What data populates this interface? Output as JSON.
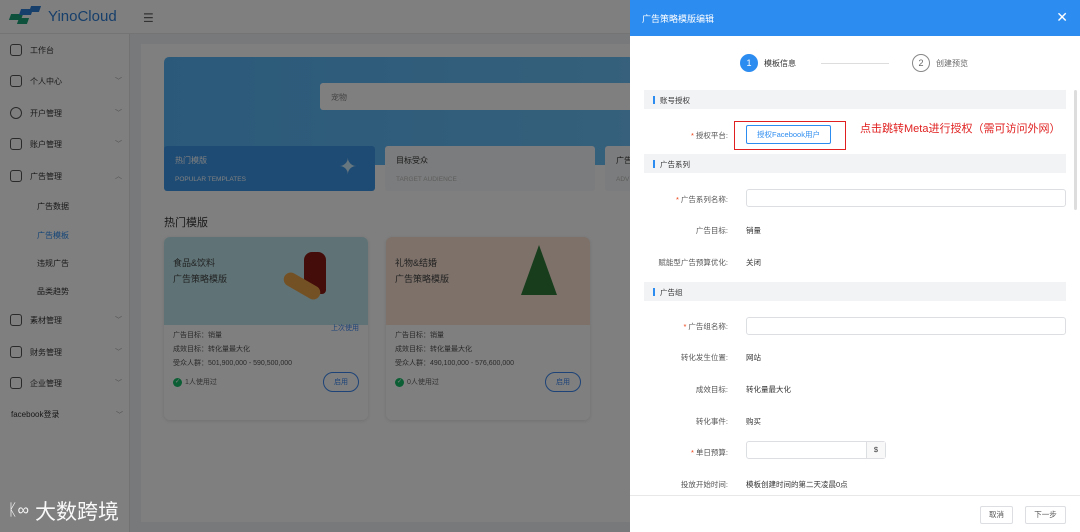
{
  "header": {
    "logo_text": "YinoCloud",
    "menu_icon": "menu-fold-icon"
  },
  "sidebar": {
    "items": [
      {
        "label": "工作台",
        "icon": "home-icon"
      },
      {
        "label": "个人中心",
        "icon": "user-icon"
      },
      {
        "label": "开户管理",
        "icon": "account-open-icon"
      },
      {
        "label": "账户管理",
        "icon": "layers-icon"
      },
      {
        "label": "广告管理",
        "icon": "ad-icon"
      },
      {
        "label": "素材管理",
        "icon": "image-icon"
      },
      {
        "label": "财务管理",
        "icon": "wallet-icon"
      },
      {
        "label": "企业管理",
        "icon": "building-icon"
      },
      {
        "label": "facebook登录",
        "icon": ""
      }
    ],
    "sub_items": [
      "广告数据",
      "广告模板",
      "违规广告",
      "品类趋势"
    ],
    "active_sub": "广告模板"
  },
  "main": {
    "search_value": "宠物",
    "tabs": [
      {
        "title": "热门模版",
        "subtitle": "POPULAR TEMPLATES"
      },
      {
        "title": "目标受众",
        "subtitle": "TARGET AUDIENCE"
      },
      {
        "title": "广告",
        "subtitle": "ADV"
      }
    ],
    "section_title": "热门模版",
    "cards": [
      {
        "title1": "食品&饮料",
        "title2": "广告策略模版",
        "goal": "广告目标：销量",
        "result": "成效目标：转化量最大化",
        "audience": "受众人群：501,900,000 - 590,500,000",
        "used": "1人使用过",
        "last_used": "上次使用",
        "button": "启用"
      },
      {
        "title1": "礼物&结婚",
        "title2": "广告策略模版",
        "goal": "广告目标：销量",
        "result": "成效目标：转化量最大化",
        "audience": "受众人群：490,100,000 - 576,600,000",
        "used": "0人使用过",
        "button": "启用"
      }
    ]
  },
  "watermark": "大数跨境",
  "drawer": {
    "title": "广告策略模版编辑",
    "steps": [
      {
        "num": "1",
        "label": "模板信息"
      },
      {
        "num": "2",
        "label": "创建预览"
      }
    ],
    "sections": {
      "auth": "账号授权",
      "campaign": "广告系列",
      "adset": "广告组"
    },
    "auth_label": "授权平台:",
    "auth_button": "授权Facebook用户",
    "annotation": "点击跳转Meta进行授权（需可访问外网）",
    "campaign_name_label": "广告系列名称:",
    "campaign_goal_label": "广告目标:",
    "campaign_goal": "销量",
    "cbo_label": "赋能型广告预算优化:",
    "cbo": "关闭",
    "adset_name_label": "广告组名称:",
    "conv_loc_label": "转化发生位置:",
    "conv_loc": "网站",
    "perf_goal_label": "成效目标:",
    "perf_goal": "转化量最大化",
    "conv_event_label": "转化事件:",
    "conv_event": "购买",
    "budget_label": "单日预算:",
    "currency": "$",
    "start_label": "投放开始时间:",
    "start": "模板创建时间的第二天凌晨0点",
    "cancel": "取消",
    "next": "下一步"
  }
}
